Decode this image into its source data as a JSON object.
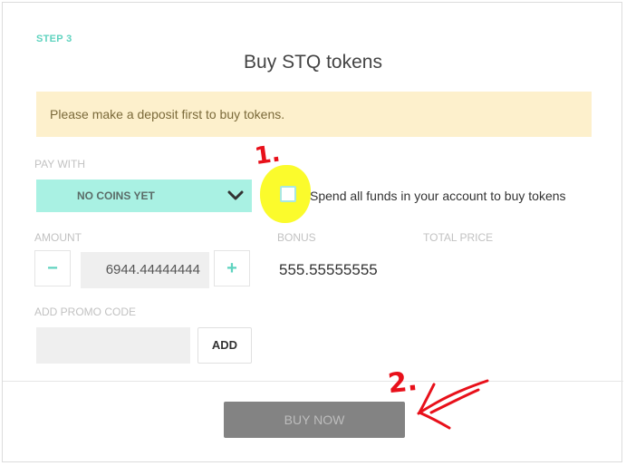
{
  "header": {
    "step": "STEP 3",
    "title": "Buy STQ tokens"
  },
  "notice": "Please make a deposit first to buy tokens.",
  "pay_with": {
    "label": "PAY WITH",
    "selected": "NO COINS YET",
    "icon": "chevron-down-icon"
  },
  "spend_all": {
    "label": "Spend all funds in your account to buy tokens",
    "checked": false
  },
  "amount": {
    "label": "AMOUNT",
    "decrement": "−",
    "value": "6944.44444444",
    "increment": "+"
  },
  "bonus": {
    "label": "BONUS",
    "value": "555.55555555"
  },
  "total_price": {
    "label": "TOTAL PRICE"
  },
  "promo": {
    "label": "ADD PROMO CODE",
    "value": "",
    "add_label": "ADD"
  },
  "buy_label": "BUY NOW",
  "annotations": {
    "mark_1": "1.",
    "mark_2": "2."
  },
  "colors": {
    "accent": "#5fd3bf",
    "select_bg": "#a9f1e3",
    "notice_bg": "#fdf0cc",
    "highlight": "#fbfb2c",
    "annotation": "#e8101a",
    "buy_button": "#838383"
  }
}
